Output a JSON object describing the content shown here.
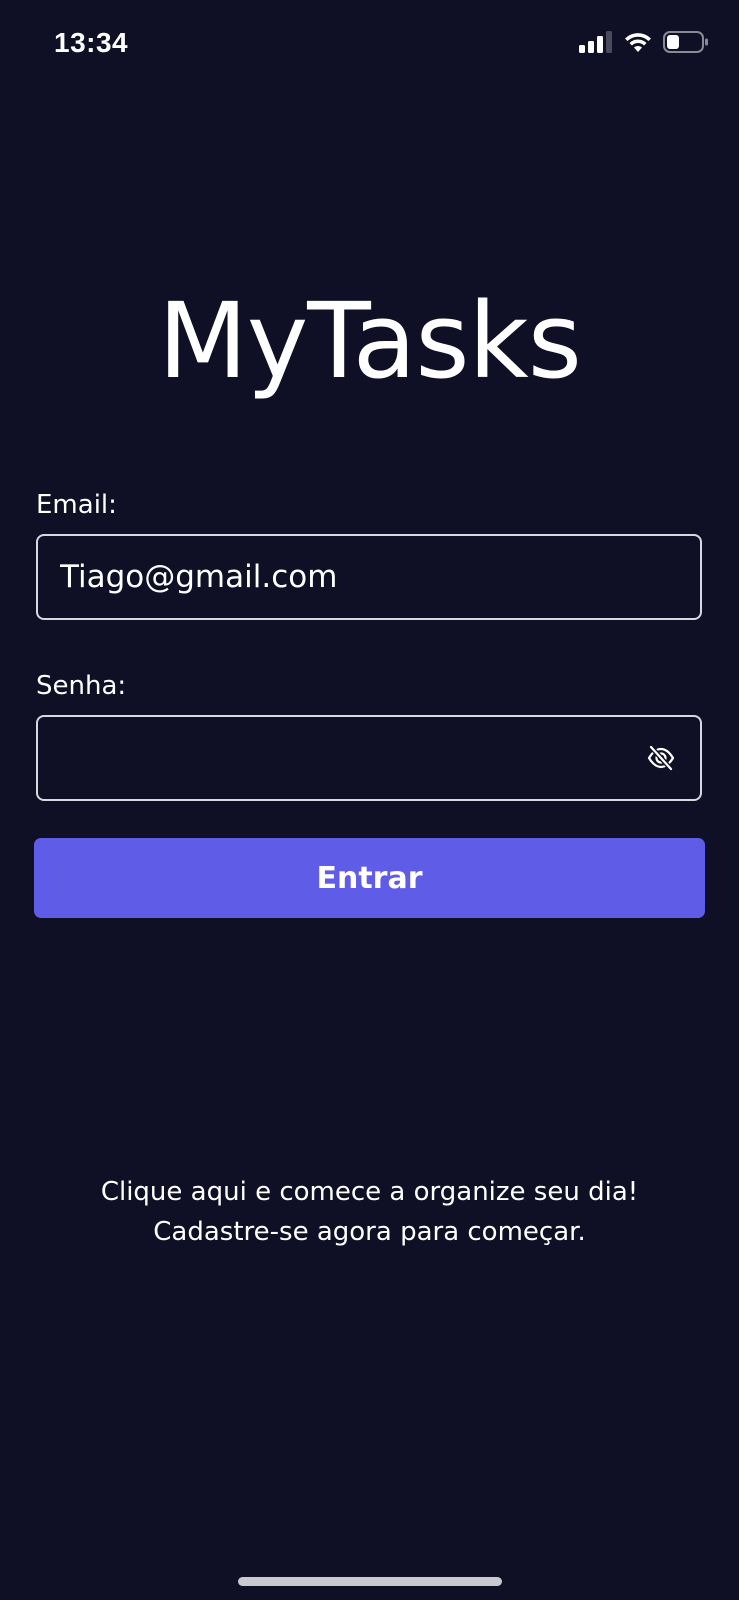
{
  "status_bar": {
    "time": "13:34",
    "icons": [
      "signal-icon",
      "wifi-icon",
      "battery-icon"
    ]
  },
  "app": {
    "title": "MyTasks"
  },
  "form": {
    "email_label": "Email:",
    "email_value": "Tiago@gmail.com",
    "password_label": "Senha:",
    "password_value": "",
    "password_toggle_icon": "eye-off-icon",
    "submit_label": "Entrar"
  },
  "signup": {
    "line1": "Clique aqui e comece a organize seu dia!",
    "line2": "Cadastre-se agora para começar."
  },
  "colors": {
    "background": "#0f1025",
    "accent": "#5f5ce8",
    "input_border": "#d8d8e0",
    "text": "#ffffff"
  }
}
